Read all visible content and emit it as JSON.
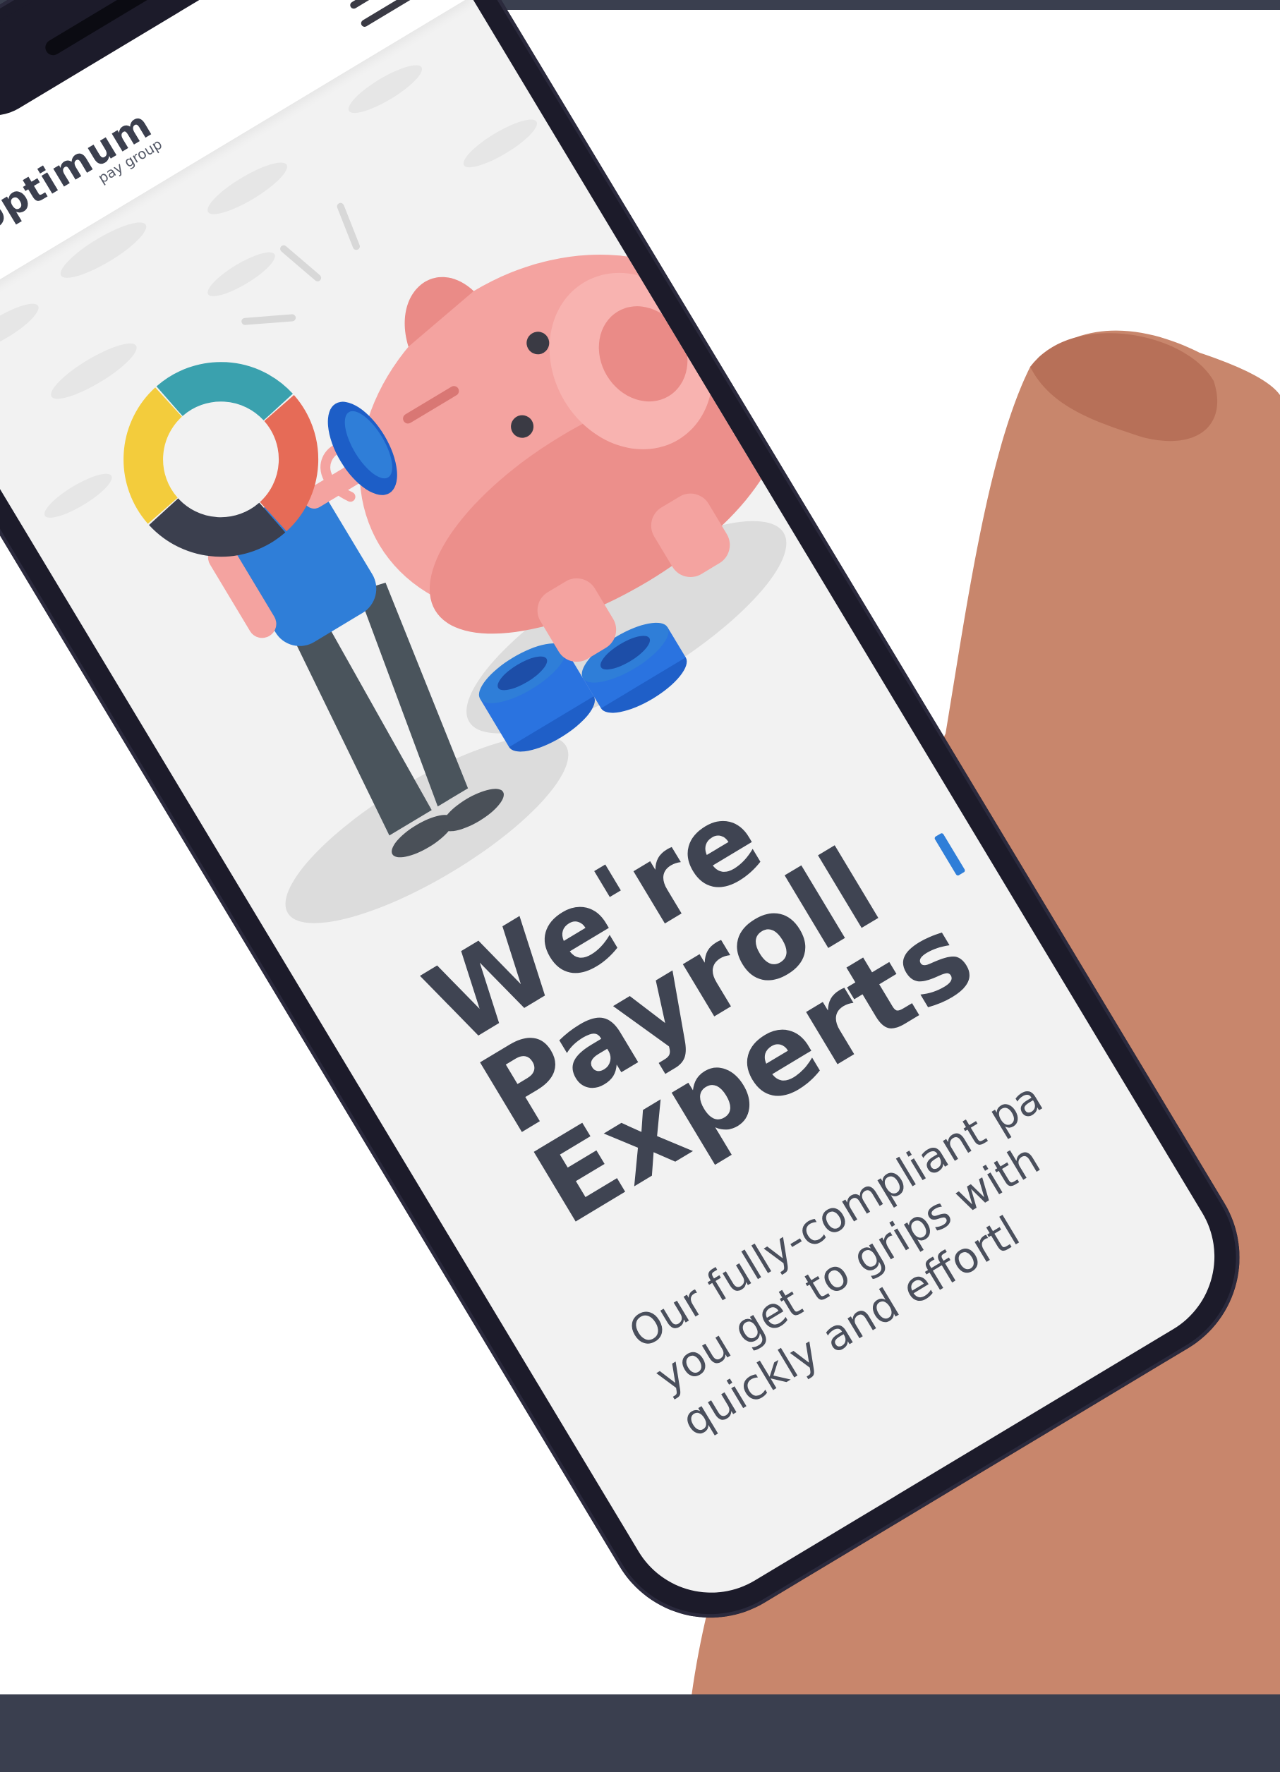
{
  "site": {
    "brand_name": "optimum",
    "brand_tagline": "pay group"
  },
  "hero": {
    "title_lines": [
      "We're",
      "Payroll",
      "Experts"
    ],
    "body_lines": [
      "Our fully-compliant pa",
      "you get to grips with",
      "quickly and effortl"
    ]
  },
  "colors": {
    "page_background": "#ffffff",
    "frame_band": "#3a3f4f",
    "phone_body": "#1c1b2a",
    "screen_background": "#f2f2f2",
    "heading_text": "#3f4452",
    "accent_blue": "#2f7ed8",
    "piggy_pink": "#f4a3a0",
    "logo_ring": [
      "#3aa1ae",
      "#e66b57",
      "#3b3f4e",
      "#f3cc3c"
    ]
  },
  "icons": {
    "menu": "hamburger-menu-icon",
    "logo": "ring-logo-mark"
  }
}
